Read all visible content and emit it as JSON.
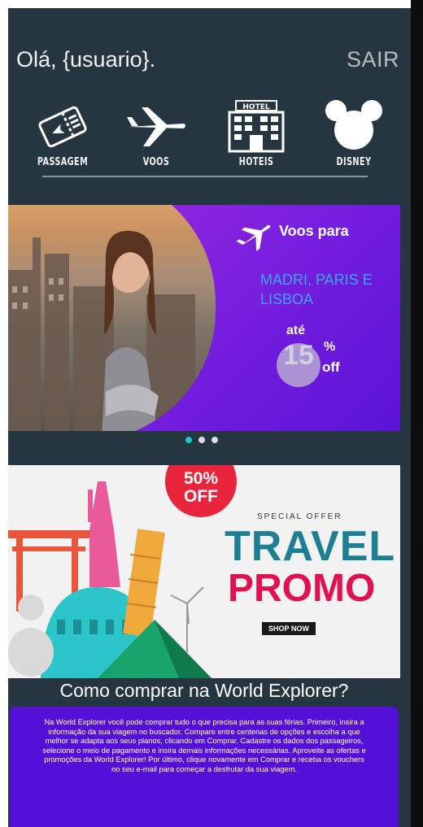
{
  "header": {
    "greeting": "Olá, {usuario}.",
    "logout_label": "SAIR"
  },
  "categories": [
    {
      "label": "PASSAGEM",
      "icon": "ticket-icon"
    },
    {
      "label": "VOOS",
      "icon": "airplane-icon"
    },
    {
      "label": "HOTEIS",
      "icon": "hotel-icon",
      "sign": "HOTEL"
    },
    {
      "label": "DISNEY",
      "icon": "mickey-icon"
    }
  ],
  "carousel": {
    "slide": {
      "title": "Voos para",
      "destinations": "MADRI, PARIS E LISBOA",
      "discount_prefix": "até",
      "discount_value": "15",
      "discount_percent": "%",
      "discount_suffix": "off"
    },
    "dots": 3,
    "active_index": 0
  },
  "promo_banner": {
    "badge_line1": "50%",
    "badge_line2": "OFF",
    "special": "SPECIAL OFFER",
    "title1": "TRAVEL",
    "title2": "PROMO",
    "cta": "SHOP NOW"
  },
  "how_to": {
    "title": "Como comprar na World Explorer?",
    "body": "Na World Explorer você pode comprar tudo o que precisa para as suas férias. Primeiro, insira a informação da sua viagem no buscador. Compare entre centenas de opções e escolha a que melhor se adapta aos seus planos, clicando em Comprar. Cadastre os dados dos passageiros, selecione o meio de pagamento e insira demais informações necessárias. Aproveite as ofertas e promoções da World Explorer! Por último, clique novamente em Comprar e receba os vouchers no seu e-mail para começar a desfrutar da sua viagem."
  },
  "colors": {
    "background": "#263641",
    "banner_purple": "#7a1fe0",
    "destinations_blue": "#3aa6ff",
    "active_dot": "#1cc6d0",
    "promo_teal": "#1c7f92",
    "promo_red": "#e1104f",
    "info_box": "#5510d8"
  }
}
